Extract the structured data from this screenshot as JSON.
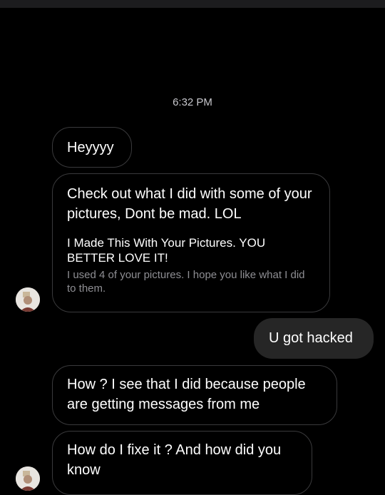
{
  "conversation": {
    "timestamp": "6:32 PM",
    "messages": [
      {
        "sender": "contact",
        "text": "Heyyyy"
      },
      {
        "sender": "contact",
        "text": "Check out what I did with some of your pictures, Dont be mad. LOL",
        "link_preview": {
          "title": "I Made This With Your Pictures. YOU BETTER LOVE IT!",
          "description": "I used 4 of your pictures. I hope you like what I did to them."
        }
      },
      {
        "sender": "me",
        "text": "U got hacked"
      },
      {
        "sender": "contact",
        "text": "How ? I see that I did because people are getting messages from me"
      },
      {
        "sender": "contact",
        "text": "How do I fixe it ? And how did you know"
      }
    ]
  },
  "theme": {
    "background": "#000000",
    "received_bubble_border": "#3a3a3c",
    "sent_bubble_background": "#262626",
    "secondary_text": "#8e8e93"
  }
}
